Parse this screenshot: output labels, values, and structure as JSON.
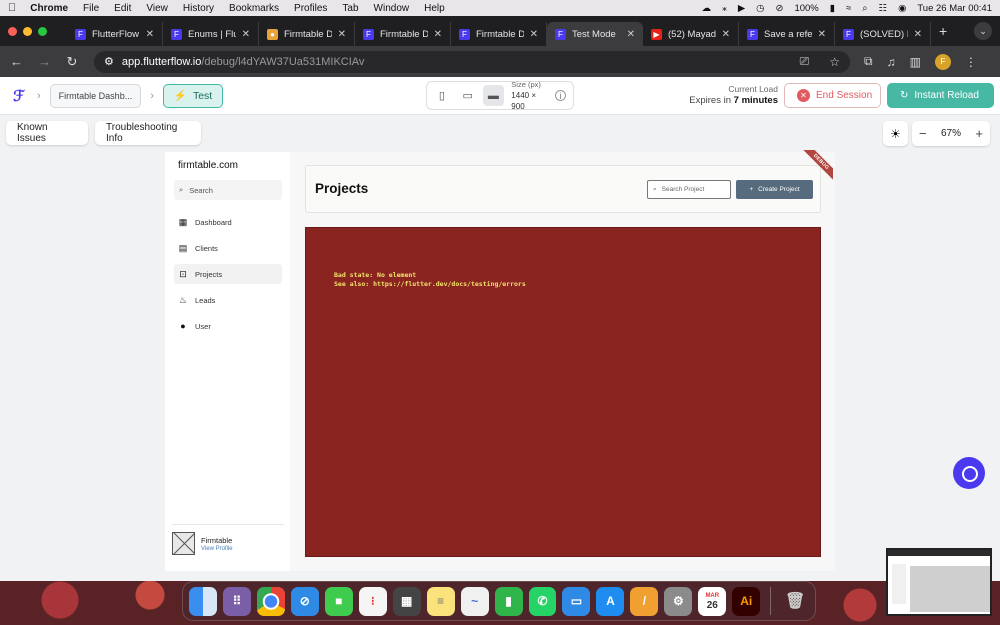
{
  "menubar": {
    "app_name": "Chrome",
    "items": [
      "File",
      "Edit",
      "View",
      "History",
      "Bookmarks",
      "Profiles",
      "Tab",
      "Window",
      "Help"
    ],
    "battery": "100%",
    "datetime": "Tue 26 Mar  00:41"
  },
  "tabs": [
    {
      "title": "FlutterFlow",
      "favicon_color": "#4b39ef",
      "active": false
    },
    {
      "title": "Enums | Flu",
      "favicon_color": "#4b39ef",
      "active": false
    },
    {
      "title": "Firmtable D",
      "favicon_color": "#e8a23a",
      "active": false
    },
    {
      "title": "Firmtable D",
      "favicon_color": "#4b39ef",
      "active": false
    },
    {
      "title": "Firmtable D",
      "favicon_color": "#4b39ef",
      "active": false
    },
    {
      "title": "Test Mode",
      "favicon_color": "#4b39ef",
      "active": true
    },
    {
      "title": "(52) Mayad",
      "favicon_color": "#e62117",
      "active": false
    },
    {
      "title": "Save a refe",
      "favicon_color": "#4b39ef",
      "active": false
    },
    {
      "title": "(SOLVED) I",
      "favicon_color": "#4b39ef",
      "active": false
    }
  ],
  "address": {
    "host": "app.flutterflow.io",
    "path": "/debug/l4dYAW37Ua531MIKCIAv"
  },
  "ffbar": {
    "project_crumb": "Firmtable Dashb...",
    "mode_label": "Test",
    "size_label": "Size (px)",
    "size_value": "1440 × 900",
    "current_load_label": "Current Load",
    "expires_prefix": "Expires in",
    "expires_value": "7 minutes",
    "end_session_label": "End Session",
    "instant_reload_label": "Instant Reload"
  },
  "toolbar": {
    "known_issues_label": "Known Issues",
    "troubleshooting_label": "Troubleshooting Info",
    "zoom_level": "67%"
  },
  "app": {
    "brand": "firmtable.com",
    "search_placeholder": "Search",
    "nav": [
      {
        "label": "Dashboard",
        "icon": "dashboard-icon",
        "active": false
      },
      {
        "label": "Clients",
        "icon": "building-icon",
        "active": false
      },
      {
        "label": "Projects",
        "icon": "projects-icon",
        "active": true
      },
      {
        "label": "Leads",
        "icon": "flame-icon",
        "active": false
      },
      {
        "label": "User",
        "icon": "person-icon",
        "active": false
      }
    ],
    "profile_name": "Firmtable",
    "profile_link": "View Profile",
    "page_title": "Projects",
    "search_project_placeholder": "Search Project",
    "create_project_label": "Create Project",
    "debug_banner": "DEBUG",
    "error_line1": "Bad state: No element",
    "error_line2": "See also: https://flutter.dev/docs/testing/errors"
  },
  "dock": {
    "calendar_month": "MAR",
    "calendar_day": "26",
    "illustrator_label": "Ai"
  },
  "colors": {
    "accent": "#4b39ef",
    "teal": "#46b8a4",
    "error_bg": "#8a2421",
    "error_text": "#f2e36b"
  }
}
